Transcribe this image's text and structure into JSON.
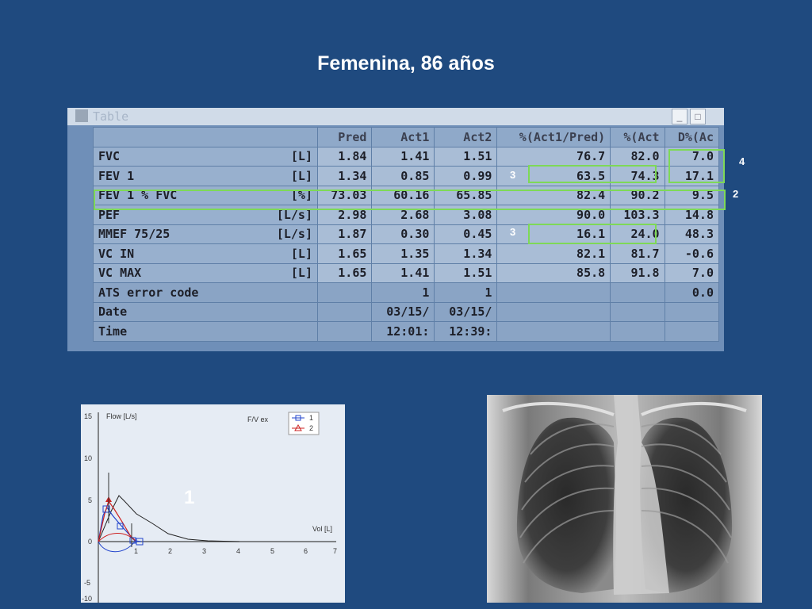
{
  "title": "Femenina, 86 años",
  "table": {
    "window_title": "Table",
    "headers": [
      "Pred",
      "Act1",
      "Act2",
      "%(Act1/Pred)",
      "%(Act",
      "D%(Ac"
    ],
    "rows": [
      {
        "label": "FVC",
        "unit": "[L]",
        "cells": [
          "1.84",
          "1.41",
          "1.51",
          "76.7",
          "82.0",
          "7.0"
        ]
      },
      {
        "label": "FEV 1",
        "unit": "[L]",
        "cells": [
          "1.34",
          "0.85",
          "0.99",
          "63.5",
          "74.3",
          "17.1"
        ]
      },
      {
        "label": "FEV 1 % FVC",
        "unit": "[%]",
        "cells": [
          "73.03",
          "60.16",
          "65.85",
          "82.4",
          "90.2",
          "9.5"
        ]
      },
      {
        "label": "PEF",
        "unit": "[L/s]",
        "cells": [
          "2.98",
          "2.68",
          "3.08",
          "90.0",
          "103.3",
          "14.8"
        ]
      },
      {
        "label": "MMEF 75/25",
        "unit": "[L/s]",
        "cells": [
          "1.87",
          "0.30",
          "0.45",
          "16.1",
          "24.0",
          "48.3"
        ]
      },
      {
        "label": "VC IN",
        "unit": "[L]",
        "cells": [
          "1.65",
          "1.35",
          "1.34",
          "82.1",
          "81.7",
          "-0.6"
        ]
      },
      {
        "label": "VC MAX",
        "unit": "[L]",
        "cells": [
          "1.65",
          "1.41",
          "1.51",
          "85.8",
          "91.8",
          "7.0"
        ]
      },
      {
        "label": "ATS error code",
        "unit": "",
        "cells": [
          "",
          "1",
          "1",
          "",
          "",
          "0.0"
        ]
      },
      {
        "label": "Date",
        "unit": "",
        "cells": [
          "",
          "03/15/",
          "03/15/",
          "",
          "",
          ""
        ]
      },
      {
        "label": "Time",
        "unit": "",
        "cells": [
          "",
          "12:01:",
          "12:39:",
          "",
          "",
          ""
        ]
      }
    ]
  },
  "markers": {
    "m4": "4",
    "m3a": "3",
    "m2": "2",
    "m3b": "3",
    "m1": "1"
  },
  "colors": {
    "highlight": "#7ed957",
    "background": "#1f4a7f"
  },
  "flow_chart": {
    "ylabel": "Flow [L/s]",
    "xlabel": "Vol [L]",
    "mode": "F/V ex",
    "legend": [
      "1",
      "2"
    ],
    "y_ticks": [
      "15",
      "10",
      "5",
      "0",
      "-5",
      "-10"
    ],
    "x_ticks": [
      "1",
      "2",
      "3",
      "4",
      "5",
      "6",
      "7"
    ]
  }
}
